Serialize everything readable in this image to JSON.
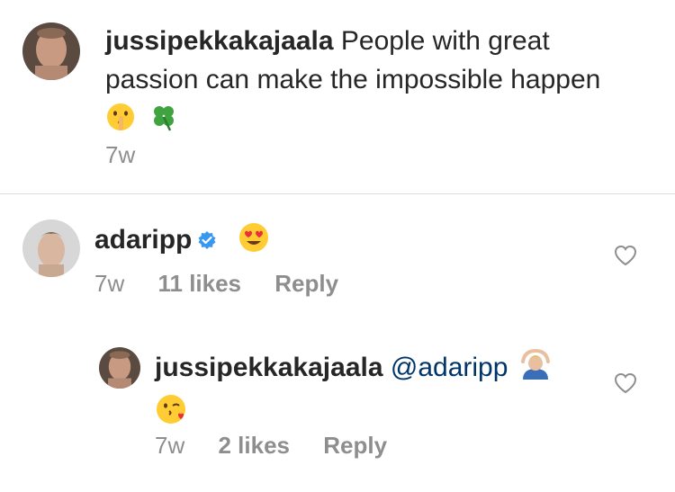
{
  "caption": {
    "username": "jussipekkakajaala",
    "text": "People with great passion can make the impossible happen",
    "emojis": [
      "shushing-face",
      "four-leaf-clover"
    ],
    "time": "7w"
  },
  "comments": [
    {
      "username": "adaripp",
      "verified": true,
      "emojis": [
        "heart-eyes"
      ],
      "time": "7w",
      "likes": "11 likes",
      "reply_label": "Reply"
    },
    {
      "username": "jussipekkakajaala",
      "mention": "@adaripp",
      "emojis": [
        "person-gesturing-ok",
        "face-blowing-kiss"
      ],
      "time": "7w",
      "likes": "2 likes",
      "reply_label": "Reply"
    }
  ],
  "colors": {
    "text": "#262626",
    "meta": "#8e8e8e",
    "mention": "#003569",
    "verified": "#3897f0",
    "divider": "#dbdbdb"
  }
}
